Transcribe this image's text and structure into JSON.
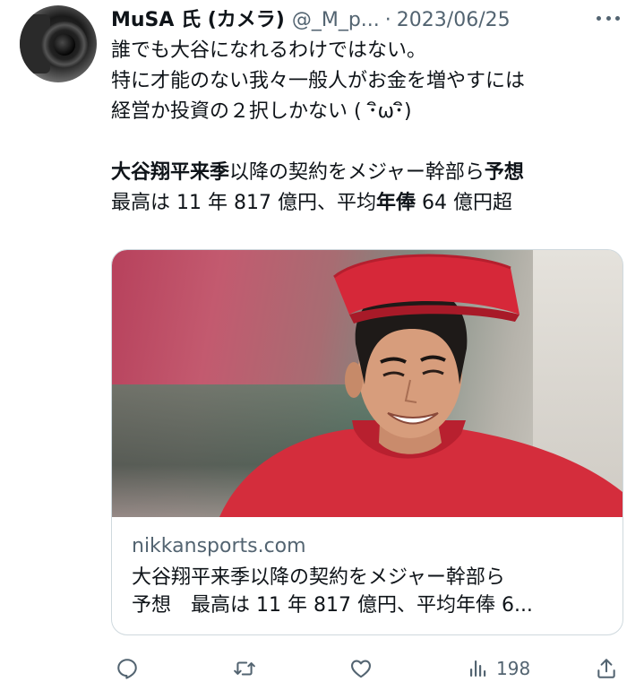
{
  "tweet": {
    "author_name": "MuSA 氏 (カメラ)",
    "handle": "@_M_p...",
    "separator": "·",
    "date": "2023/06/25",
    "lines": [
      "誰でも大谷になれるわけではない。",
      "特に才能のない我々一般人がお金を増やすには",
      "経営か投資の２択しかない ( ･ิω･ิ)"
    ],
    "headline_line1_bold1": "大谷翔平来季",
    "headline_line1_normal": "以降の契約をメジャー幹部ら",
    "headline_line1_bold2": "予想",
    "headline_line2_normal1": "最高は 11 年 817 億円、平均",
    "headline_line2_bold": "年俸",
    "headline_line2_normal2": " 64 億円超"
  },
  "card": {
    "domain": "nikkansports.com",
    "title_line1": "大谷翔平来季以降の契約をメジャー幹部ら",
    "title_line2": "予想　最高は 11 年 817 億円、平均年俸 6..."
  },
  "actions": {
    "views_count": "198"
  },
  "icons": {
    "reply": "reply-icon",
    "retweet": "retweet-icon",
    "like": "heart-icon",
    "views": "views-icon",
    "share": "share-icon",
    "more": "more-icon"
  },
  "colors": {
    "text": "#0f1419",
    "secondary": "#536471",
    "border": "#cfd9de",
    "cap_red": "#d62839"
  }
}
